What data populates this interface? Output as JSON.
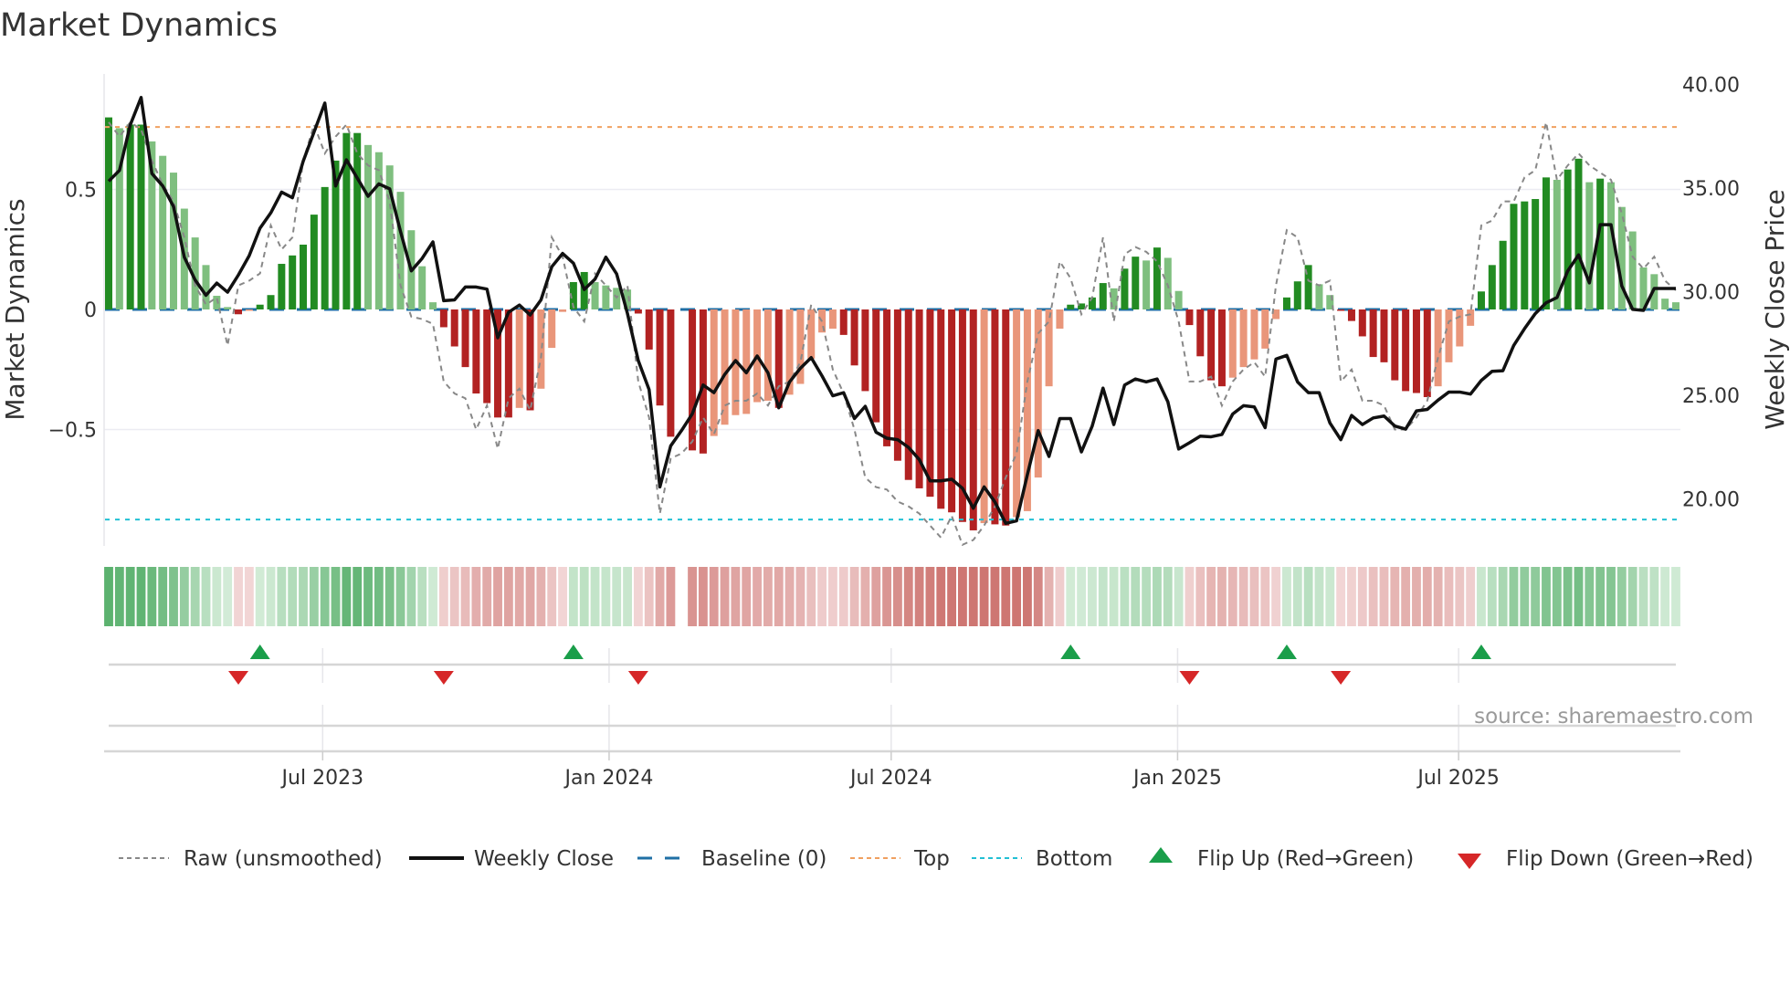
{
  "title": "Market Dynamics",
  "source": "source: sharemaestro.com",
  "legend": {
    "raw": "Raw (unsmoothed)",
    "close": "Weekly Close",
    "baseline": "Baseline (0)",
    "top": "Top",
    "bottom": "Bottom",
    "flip_up": "Flip Up (Red→Green)",
    "flip_down": "Flip Down (Green→Red)"
  },
  "colors": {
    "green_strong": "#228b22",
    "green_weak": "#7fbf7f",
    "red_strong": "#b22222",
    "red_weak": "#e9967a",
    "close": "#111111",
    "raw": "#888888",
    "baseline": "#1f6fa5",
    "top": "#f0a060",
    "bottom": "#22c0d4",
    "flip_up": "#1a9e4a",
    "flip_down": "#d62728"
  },
  "chart_data": {
    "type": "bar",
    "title": "Market Dynamics",
    "ylabel": "Market Dynamics",
    "y2label": "Weekly Close Price",
    "ylim": [
      -0.98,
      0.98
    ],
    "y2lim": [
      18,
      40
    ],
    "yticks": [
      {
        "v": 0.5,
        "label": "0.5"
      },
      {
        "v": 0,
        "label": "0"
      },
      {
        "v": -0.5,
        "label": "−0.5"
      }
    ],
    "y2ticks": [
      {
        "v": 40,
        "label": "40.00"
      },
      {
        "v": 35,
        "label": "35.00"
      },
      {
        "v": 30,
        "label": "30.00"
      },
      {
        "v": 25,
        "label": "25.00"
      },
      {
        "v": 20,
        "label": "20.00"
      }
    ],
    "xticks": [
      {
        "week_index": 19.8,
        "label": "Jul 2023"
      },
      {
        "week_index": 46.3,
        "label": "Jan 2024"
      },
      {
        "week_index": 72.4,
        "label": "Jul 2024"
      },
      {
        "week_index": 98.9,
        "label": "Jan 2025"
      },
      {
        "week_index": 124.9,
        "label": "Jul 2025"
      }
    ],
    "top_level": 0.76,
    "bottom_level": -0.875,
    "baseline": 0,
    "smoothed": [
      0.8,
      0.755,
      0.77,
      0.77,
      0.7,
      0.64,
      0.57,
      0.42,
      0.3,
      0.185,
      0.057,
      0.01,
      -0.02,
      -0.005,
      0.02,
      0.06,
      0.19,
      0.225,
      0.27,
      0.395,
      0.51,
      0.62,
      0.735,
      0.735,
      0.685,
      0.655,
      0.6,
      0.49,
      0.33,
      0.18,
      0.03,
      -0.074,
      -0.154,
      -0.24,
      -0.35,
      -0.39,
      -0.45,
      -0.45,
      -0.41,
      -0.42,
      -0.33,
      -0.16,
      -0.01,
      0.114,
      0.156,
      0.114,
      0.1,
      0.09,
      0.083,
      -0.017,
      -0.167,
      -0.4,
      -0.53,
      null,
      -0.587,
      -0.6,
      -0.527,
      -0.48,
      -0.44,
      -0.435,
      -0.386,
      -0.38,
      -0.41,
      -0.355,
      -0.31,
      -0.205,
      -0.096,
      -0.08,
      -0.106,
      -0.233,
      -0.34,
      -0.47,
      -0.57,
      -0.63,
      -0.71,
      -0.745,
      -0.78,
      -0.83,
      -0.845,
      -0.885,
      -0.92,
      -0.89,
      -0.895,
      -0.9,
      -0.865,
      -0.84,
      -0.7,
      -0.32,
      -0.08,
      0.02,
      0.025,
      0.05,
      0.11,
      0.088,
      0.17,
      0.22,
      0.204,
      0.258,
      0.215,
      0.077,
      -0.065,
      -0.195,
      -0.295,
      -0.32,
      -0.284,
      -0.24,
      -0.208,
      -0.163,
      -0.04,
      0.05,
      0.117,
      0.185,
      0.105,
      0.06,
      -0.005,
      -0.048,
      -0.112,
      -0.198,
      -0.22,
      -0.295,
      -0.34,
      -0.348,
      -0.365,
      -0.32,
      -0.22,
      -0.154,
      -0.068,
      0.075,
      0.185,
      0.286,
      0.44,
      0.45,
      0.46,
      0.55,
      0.54,
      0.583,
      0.628,
      0.53,
      0.545,
      0.53,
      0.427,
      0.325,
      0.175,
      0.147,
      0.045,
      0.03
    ],
    "raw": [
      0.78,
      0.72,
      0.78,
      0.75,
      0.62,
      0.52,
      0.45,
      0.3,
      0.1,
      0.02,
      0.05,
      -0.15,
      0.1,
      0.12,
      0.15,
      0.35,
      0.25,
      0.3,
      0.62,
      0.77,
      0.65,
      0.72,
      0.77,
      0.65,
      0.6,
      0.58,
      0.45,
      0.1,
      -0.03,
      -0.04,
      -0.06,
      -0.3,
      -0.35,
      -0.37,
      -0.5,
      -0.4,
      -0.58,
      -0.37,
      -0.33,
      -0.42,
      -0.2,
      0.3,
      0.22,
      0.01,
      -0.05,
      0.15,
      0.1,
      0.05,
      0.1,
      -0.3,
      -0.45,
      -0.85,
      -0.62,
      -0.6,
      -0.55,
      -0.45,
      -0.52,
      -0.4,
      -0.38,
      -0.38,
      -0.35,
      -0.4,
      -0.32,
      -0.3,
      -0.22,
      0.02,
      -0.05,
      -0.25,
      -0.35,
      -0.5,
      -0.7,
      -0.74,
      -0.75,
      -0.8,
      -0.82,
      -0.85,
      -0.9,
      -0.95,
      -0.86,
      -0.98,
      -0.96,
      -0.9,
      -0.82,
      -0.7,
      -0.6,
      -0.3,
      -0.1,
      -0.05,
      0.2,
      0.13,
      -0.02,
      0.05,
      0.3,
      -0.05,
      0.23,
      0.26,
      0.24,
      0.2,
      0.1,
      -0.05,
      -0.3,
      -0.3,
      -0.28,
      -0.4,
      -0.3,
      -0.25,
      -0.22,
      -0.28,
      0.1,
      0.33,
      0.3,
      0.12,
      0.1,
      0.12,
      -0.3,
      -0.25,
      -0.38,
      -0.38,
      -0.4,
      -0.5,
      -0.5,
      -0.45,
      -0.38,
      -0.2,
      -0.05,
      -0.03,
      -0.02,
      0.35,
      0.37,
      0.45,
      0.45,
      0.55,
      0.58,
      0.78,
      0.54,
      0.6,
      0.65,
      0.6,
      0.57,
      0.54,
      0.4,
      0.22,
      0.17,
      0.22,
      0.12,
      0.08
    ],
    "weekly_close": [
      35.33,
      35.85,
      38.05,
      39.37,
      35.7,
      35.1,
      34.1,
      31.66,
      30.56,
      29.82,
      30.41,
      29.97,
      30.8,
      31.73,
      33.06,
      33.8,
      34.8,
      34.53,
      36.3,
      37.7,
      39.1,
      35.1,
      36.36,
      35.48,
      34.6,
      35.2,
      34.96,
      32.9,
      31.0,
      31.6,
      32.4,
      29.56,
      29.6,
      30.22,
      30.22,
      30.12,
      27.77,
      29.0,
      29.35,
      28.87,
      29.6,
      31.2,
      31.84,
      31.37,
      30.1,
      30.6,
      31.66,
      30.85,
      28.94,
      26.67,
      25.27,
      20.57,
      22.55,
      23.29,
      24.1,
      25.49,
      25.12,
      26.0,
      26.67,
      26.08,
      26.89,
      26.08,
      24.39,
      25.64,
      26.3,
      26.81,
      25.93,
      24.97,
      25.12,
      23.87,
      24.46,
      23.21,
      22.92,
      22.85,
      22.48,
      21.89,
      20.86,
      20.86,
      20.94,
      20.5,
      19.54,
      20.57,
      19.84,
      18.81,
      18.93,
      21.16,
      23.29,
      22.04,
      23.87,
      23.87,
      22.26,
      23.51,
      25.34,
      23.58,
      25.49,
      25.78,
      25.64,
      25.78,
      24.68,
      22.4,
      22.7,
      23.02,
      22.99,
      23.1,
      24.09,
      24.49,
      24.43,
      23.43,
      26.74,
      26.92,
      25.64,
      25.12,
      25.12,
      23.65,
      22.85,
      24.02,
      23.58,
      23.9,
      23.99,
      23.51,
      23.36,
      24.24,
      24.31,
      24.76,
      25.15,
      25.15,
      25.05,
      25.71,
      26.15,
      26.18,
      27.4,
      28.21,
      28.94,
      29.46,
      29.71,
      31.0,
      31.77,
      30.42,
      33.23,
      33.23,
      30.27,
      29.14,
      29.09,
      30.15,
      30.15,
      30.15
    ],
    "flips_up": [
      14,
      43,
      89,
      109,
      127
    ],
    "flips_down": [
      12,
      31,
      49,
      100,
      114
    ],
    "legend_position": "bottom"
  }
}
